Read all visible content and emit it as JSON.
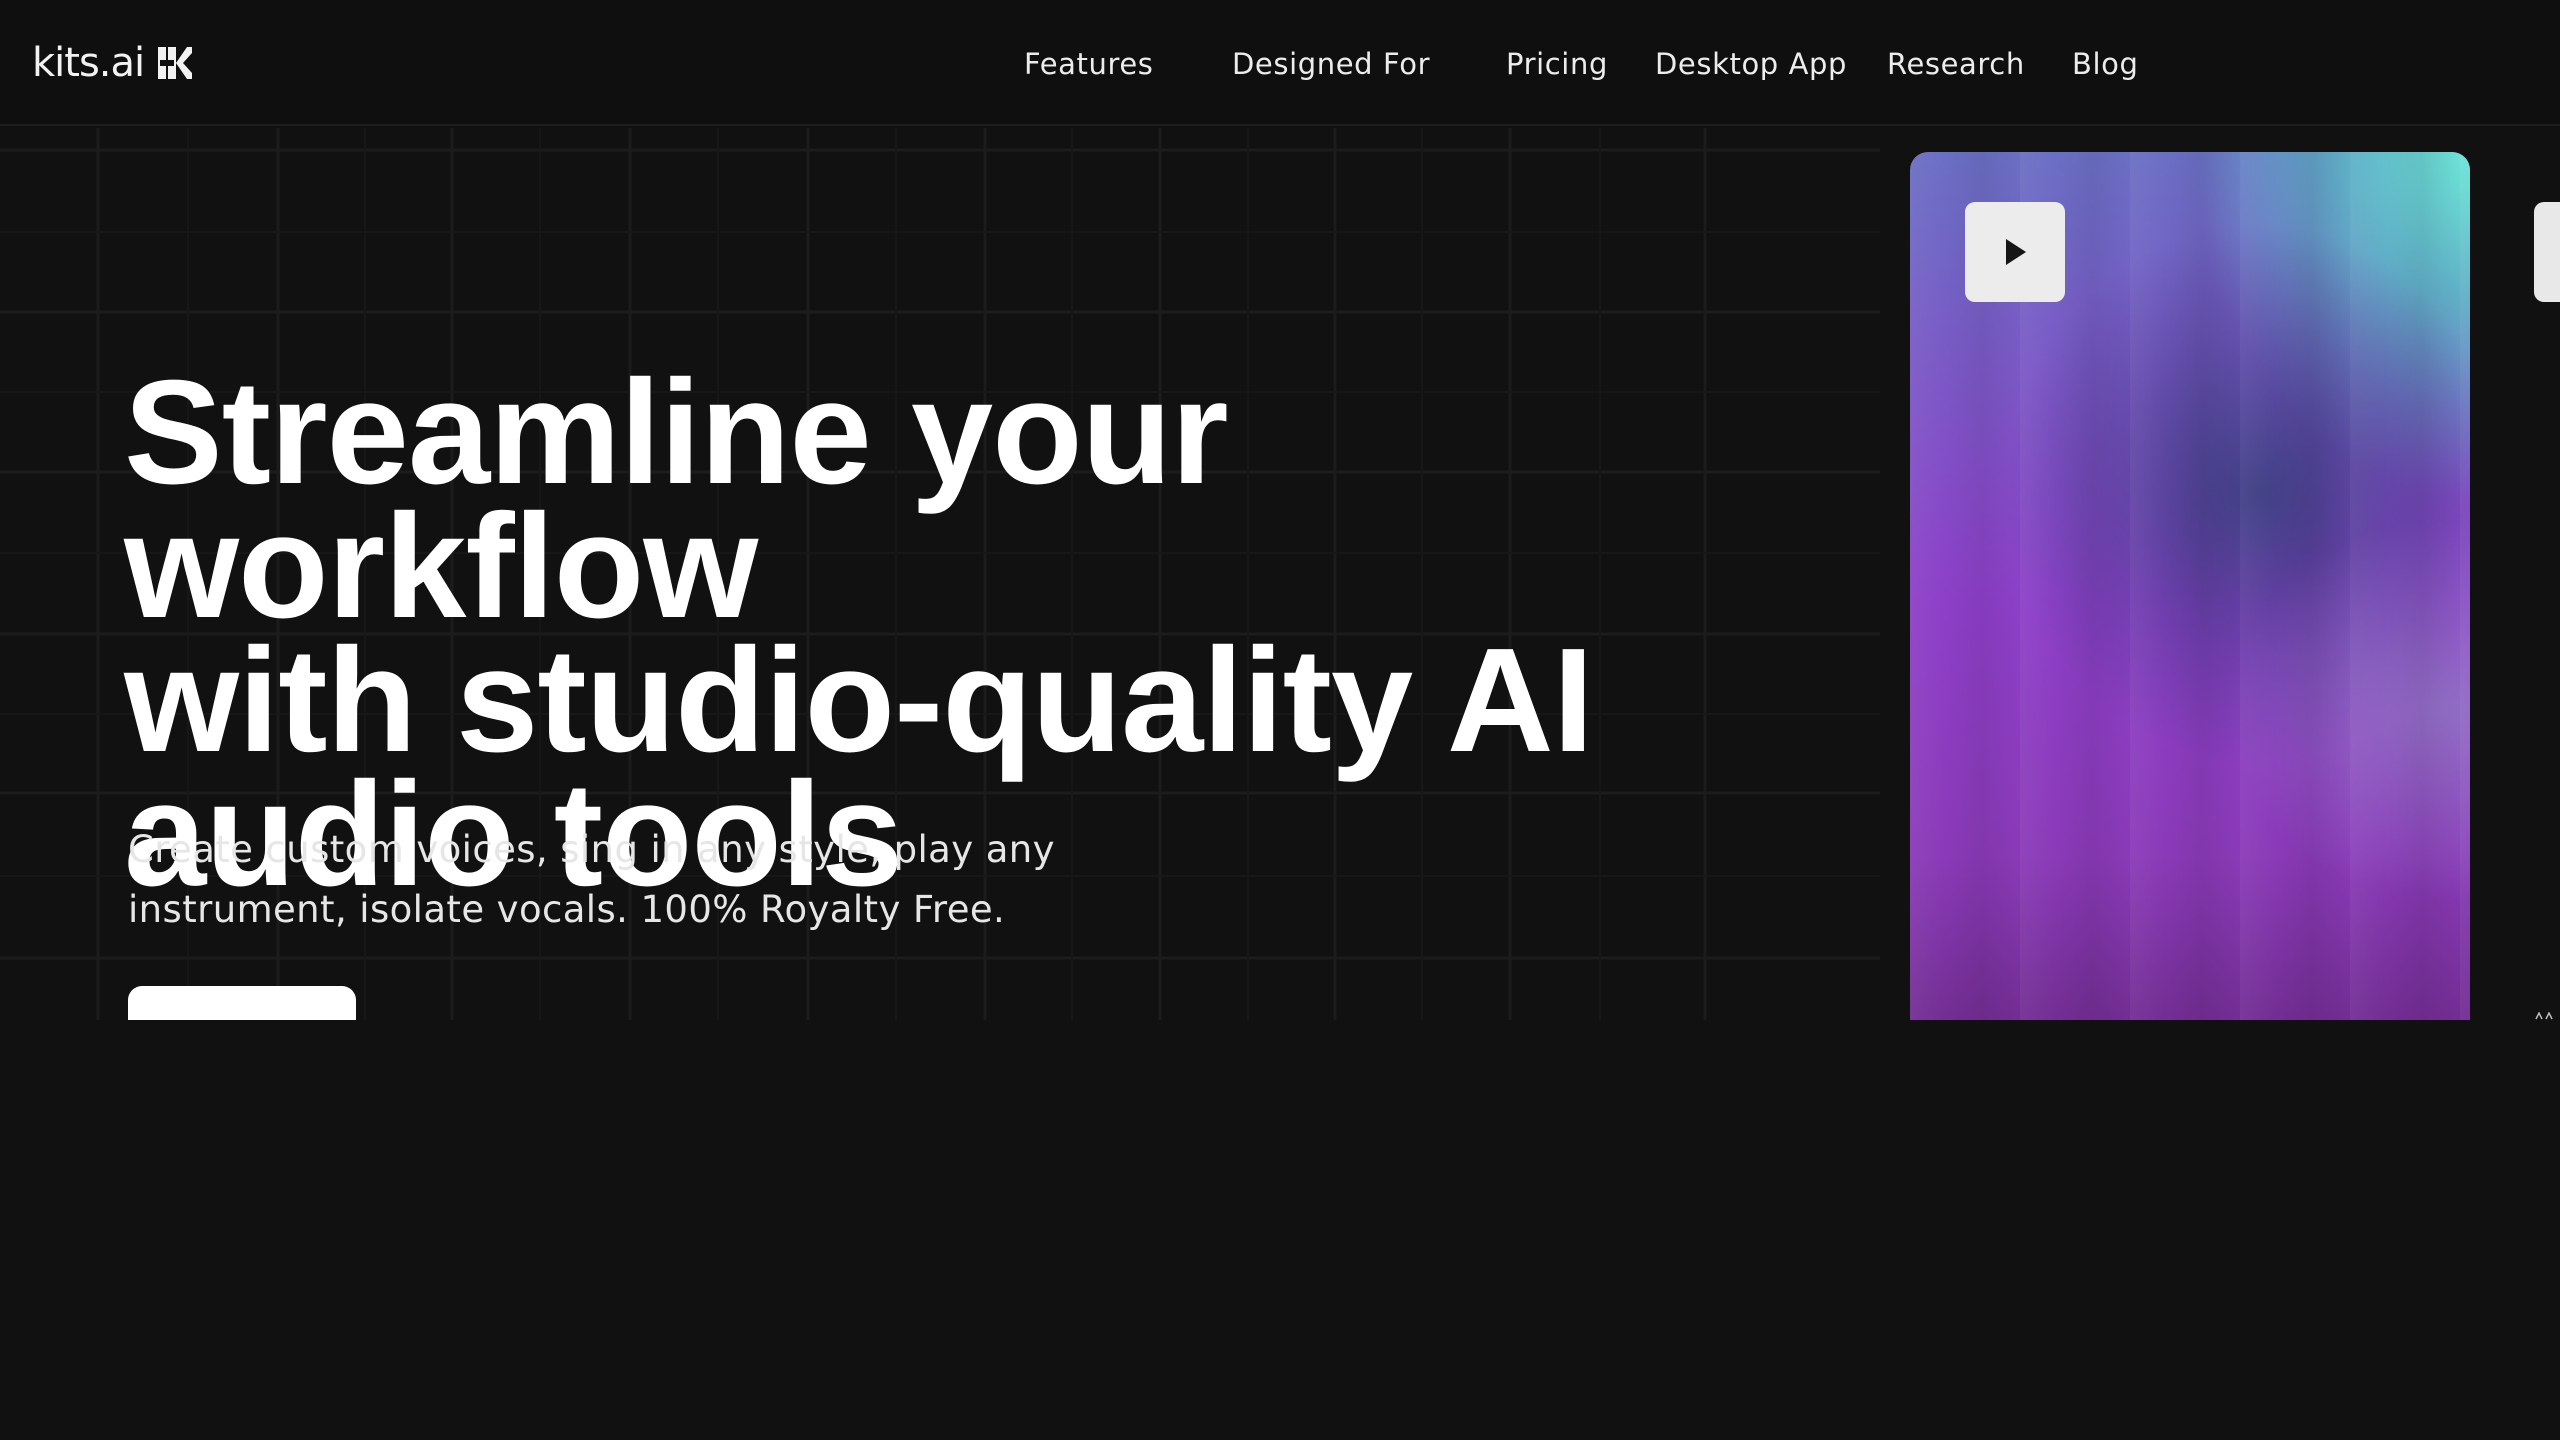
{
  "brand": {
    "logo_text": "kits.ai",
    "logo_icon": "kits-k-logo-icon"
  },
  "nav": {
    "items": [
      {
        "label": "Features"
      },
      {
        "label": "Designed For"
      },
      {
        "label": "Pricing"
      },
      {
        "label": "Desktop App"
      },
      {
        "label": "Research"
      },
      {
        "label": "Blog"
      }
    ]
  },
  "hero": {
    "headline_line1": "Streamline your workflow",
    "headline_line2": "with studio-quality AI",
    "headline_line3": "audio tools",
    "subtext_line1": "Create custom voices, sing in any style, play any",
    "subtext_line2": "instrument, isolate vocals. 100% Royalty Free.",
    "cta_label": "",
    "play_icon": "play-icon"
  },
  "colors": {
    "background": "#111111",
    "nav_background": "#0f0f0f",
    "text": "#ffffff",
    "card_teal": "#6ee6d7",
    "card_purple": "#8d3fc8",
    "button": "#ffffff"
  }
}
